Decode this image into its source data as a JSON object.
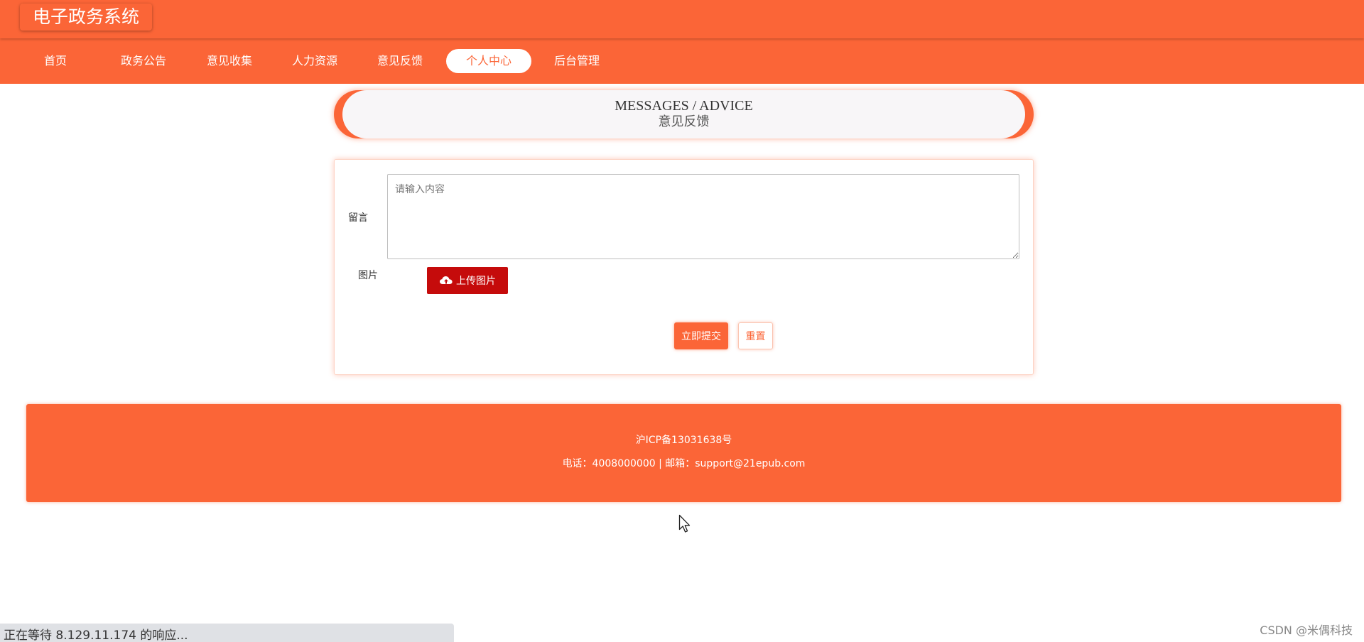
{
  "header": {
    "site_title": "电子政务系统"
  },
  "nav": {
    "items": [
      {
        "label": "首页"
      },
      {
        "label": "政务公告"
      },
      {
        "label": "意见收集"
      },
      {
        "label": "人力资源"
      },
      {
        "label": "意见反馈"
      },
      {
        "label": "个人中心",
        "active": true
      },
      {
        "label": "后台管理"
      }
    ]
  },
  "section": {
    "title_en": "MESSAGES / ADVICE",
    "title_cn": "意见反馈"
  },
  "form": {
    "message_label": "留言",
    "message_placeholder": "请输入内容",
    "message_value": "",
    "image_label": "图片",
    "upload_label": "上传图片",
    "submit_label": "立即提交",
    "reset_label": "重置"
  },
  "footer": {
    "icp": "沪ICP备13031638号",
    "contact": "电话：4008000000 | 邮箱：support@21epub.com"
  },
  "browser": {
    "status_text": "正在等待 8.129.11.174 的响应..."
  },
  "watermark": {
    "text": "CSDN @米偶科技"
  },
  "theme": {
    "accent": "#fb6537",
    "upload_button_color": "#c50b0b"
  },
  "icons": {
    "upload": "cloud-upload-icon",
    "cursor": "mouse-cursor-icon"
  }
}
